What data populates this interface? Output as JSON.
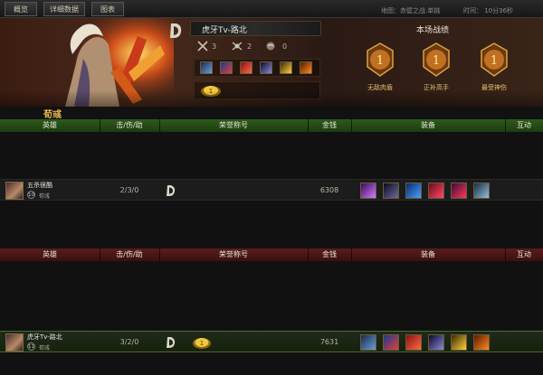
{
  "top_bar": {
    "tabs": [
      "概览",
      "详细数据",
      "图表"
    ],
    "map_text": "地图：赤壁之战.单挑",
    "time_text": "时间： 10分36秒"
  },
  "summary": {
    "player_name": "虎牙Tv-路北",
    "kills": "3",
    "deaths": "2",
    "assists": "0",
    "equipment_icons": [
      "spear-item-icon",
      "blue-helm-item-icon",
      "red-armor-item-icon",
      "dark-staff-item-icon",
      "gold-lamp-item-icon",
      "fire-lamp-item-icon"
    ],
    "stats_title": "本场战绩",
    "medals": [
      {
        "rank": "1",
        "label": "无敌肉盾"
      },
      {
        "rank": "1",
        "label": "正补高手"
      },
      {
        "rank": "1",
        "label": "最受神伤"
      }
    ]
  },
  "team_label": "荀彧",
  "table_headers": [
    "英雄",
    "击/伤/助",
    "荣誉称号",
    "金钱",
    "装备",
    "互动"
  ],
  "team1": {
    "players": [
      {
        "name": "五杀很酷",
        "level": "10",
        "hero": "荀彧",
        "kda": "2/3/0",
        "money": "6308",
        "items": [
          "purple-orb-item-icon",
          "dark-spear-item-icon",
          "blue-potion-item-icon",
          "red-potion-item-icon",
          "red-orb-item-icon",
          "sword-item-icon"
        ]
      }
    ]
  },
  "team2": {
    "players": [
      {
        "name": "虎牙Tv-路北",
        "level": "11",
        "hero": "荀彧",
        "kda": "3/2/0",
        "money": "7631",
        "items": [
          "spear-item-icon",
          "blue-helm-item-icon",
          "red-armor-item-icon",
          "dark-staff-item-icon",
          "gold-lamp-item-icon",
          "fire-lamp-item-icon"
        ]
      }
    ]
  },
  "colors": {
    "gold_text": "#e6b84a",
    "green_header": "#2e5a1c",
    "red_header": "#5a1c1c"
  }
}
